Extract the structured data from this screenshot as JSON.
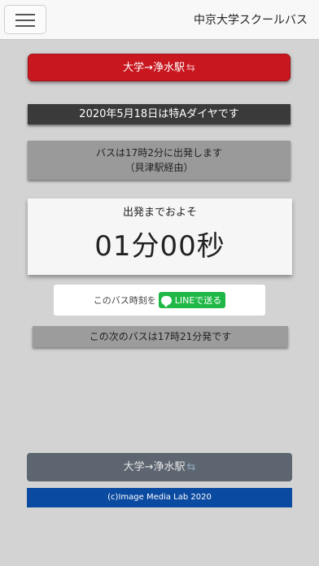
{
  "header": {
    "menu_icon": "hamburger-icon",
    "title": "中京大学スクールバス"
  },
  "route_button": {
    "label": "大学→浄水駅",
    "swap_glyph": "⇆",
    "color": "#c8171f"
  },
  "diagram_notice": "2020年5月18日は特Aダイヤです",
  "departure": {
    "line1": "バスは17時2分に出発します",
    "line2": "（貝津駅経由）"
  },
  "countdown": {
    "caption": "出発までおよそ",
    "time": "01分00秒"
  },
  "share": {
    "text": "このバス時刻を",
    "line_button_label": "LINEで送る",
    "line_color": "#1fb846"
  },
  "next_bus": "この次のバスは17時21分発です",
  "bottom_route_button": {
    "label": "大学→浄水駅",
    "swap_glyph": "⇆"
  },
  "footer": "(c)Image Media Lab 2020"
}
